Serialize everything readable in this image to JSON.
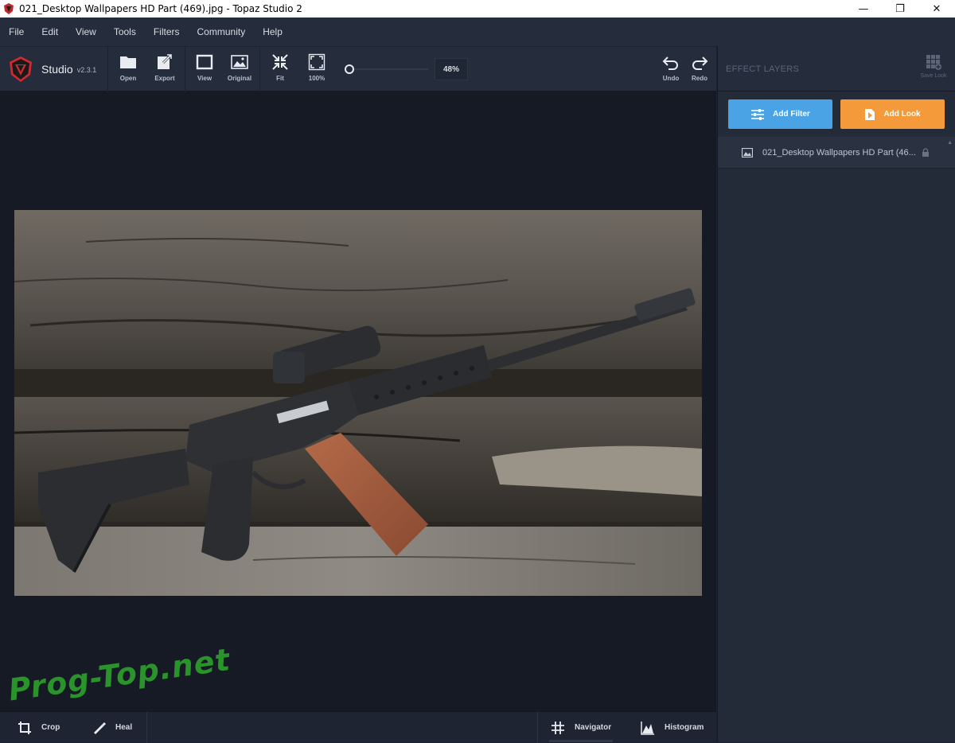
{
  "window": {
    "title": "021_Desktop Wallpapers  HD Part (469).jpg - Topaz Studio 2",
    "minimize": "—",
    "maximize": "❐",
    "close": "✕"
  },
  "menu": {
    "items": [
      {
        "label": "File"
      },
      {
        "label": "Edit"
      },
      {
        "label": "View"
      },
      {
        "label": "Tools"
      },
      {
        "label": "Filters"
      },
      {
        "label": "Community"
      },
      {
        "label": "Help"
      }
    ]
  },
  "toolbar": {
    "app_name": "Studio",
    "version": "v2.3.1",
    "open_label": "Open",
    "export_label": "Export",
    "view_label": "View",
    "original_label": "Original",
    "fit_label": "Fit",
    "actual_label": "100%",
    "zoom_value": "48%",
    "undo_label": "Undo",
    "redo_label": "Redo"
  },
  "right_panel": {
    "title": "EFFECT LAYERS",
    "save_look_label": "Save Look",
    "add_filter_label": "Add Filter",
    "add_look_label": "Add Look",
    "layers": [
      {
        "name": "021_Desktop Wallpapers  HD Part (46..."
      }
    ]
  },
  "bottom": {
    "crop_label": "Crop",
    "heal_label": "Heal",
    "navigator_label": "Navigator",
    "histogram_label": "Histogram"
  },
  "watermark": "Prog-Top.net",
  "colors": {
    "add_filter": "#4aa3e4",
    "add_look": "#f59a3a",
    "panel_bg": "#232a38",
    "canvas_bg": "#151a24"
  }
}
